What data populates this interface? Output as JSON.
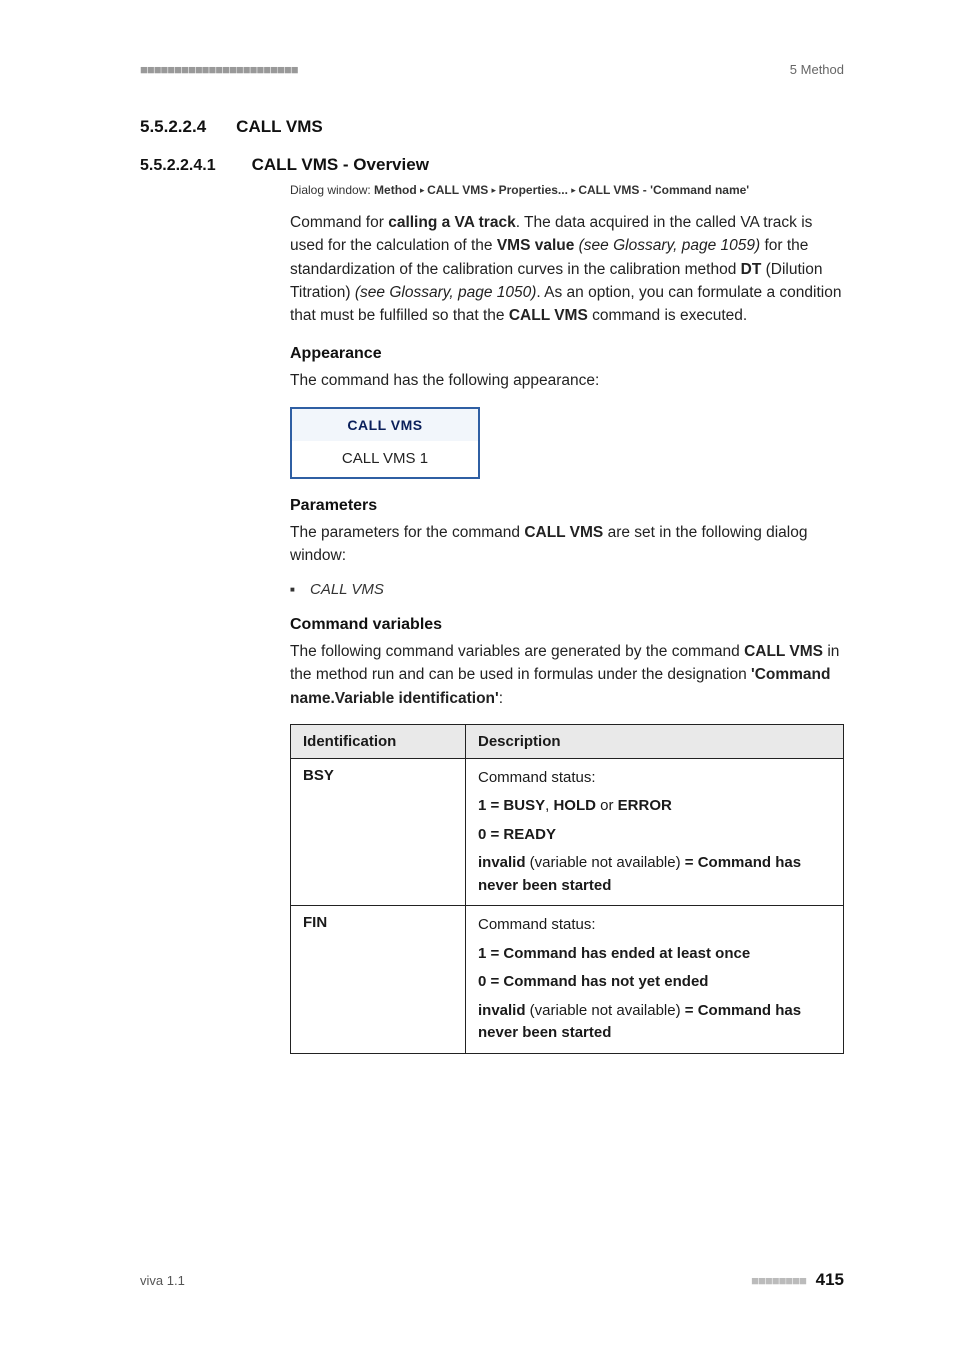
{
  "header": {
    "dashes": "■■■■■■■■■■■■■■■■■■■■■■■",
    "chapter": "5 Method"
  },
  "sectionA": {
    "num": "5.5.2.2.4",
    "title": "CALL VMS"
  },
  "sectionB": {
    "num": "5.5.2.2.4.1",
    "title": "CALL VMS - Overview"
  },
  "dialog": {
    "prefix": "Dialog window: ",
    "p1": "Method",
    "p2": "CALL VMS",
    "p3": "Properties...",
    "p4": "CALL VMS - 'Command name'"
  },
  "intro": {
    "t1": "Command for ",
    "b1": "calling a VA track",
    "t2": ". The data acquired in the called VA track is used for the calculation of the ",
    "b2": "VMS value",
    "i1": " (see Glossary, page 1059)",
    "t3": " for the standardization of the calibration curves in the calibration method ",
    "b3": "DT",
    "t3b": " (Dilution Titration) ",
    "i2": "(see Glossary, page 1050)",
    "t4": ". As an option, you can formulate a condition that must be fulfilled so that the ",
    "b4": "CALL VMS",
    "t5": " command is executed."
  },
  "appearance": {
    "heading": "Appearance",
    "text": "The command has the following appearance:",
    "boxTop": "CALL VMS",
    "boxBot": "CALL VMS 1"
  },
  "parameters": {
    "heading": "Parameters",
    "t1": "The parameters for the command ",
    "b1": "CALL VMS",
    "t2": " are set in the following dialog window:",
    "item1": "CALL VMS"
  },
  "cmdvars": {
    "heading": "Command variables",
    "t1": "The following command variables are generated by the command ",
    "b1": "CALL VMS",
    "t2": " in the method run and can be used in formulas under the designation ",
    "b2": "'Command name.Variable identification'",
    "t3": ":"
  },
  "table": {
    "h1": "Identification",
    "h2": "Description",
    "r1id": "BSY",
    "r1l1": "Command status:",
    "r1l2a": "1 = BUSY",
    "r1l2b": ", ",
    "r1l2c": "HOLD",
    "r1l2d": " or ",
    "r1l2e": "ERROR",
    "r1l3": "0 = READY",
    "r1l4a": "invalid",
    "r1l4b": " (variable not available) ",
    "r1l4c": "= Command has never been started",
    "r2id": "FIN",
    "r2l1": "Command status:",
    "r2l2": "1 = Command has ended at least once",
    "r2l3": "0 = Command has not yet ended",
    "r2l4a": "invalid",
    "r2l4b": " (variable not available) ",
    "r2l4c": "= Command has never been started"
  },
  "footer": {
    "left": "viva 1.1",
    "dashes": "■■■■■■■■",
    "page": "415"
  }
}
